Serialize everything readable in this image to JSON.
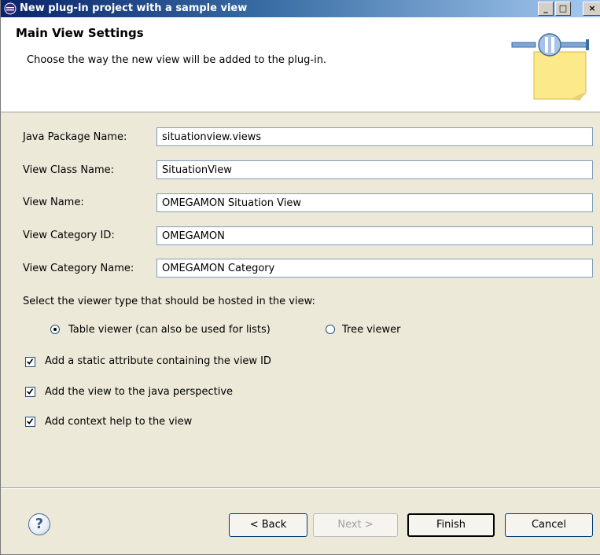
{
  "window": {
    "title": "New plug-in project with a sample view",
    "min_label": "_",
    "max_label": "□",
    "close_label": "×"
  },
  "header": {
    "title": "Main View Settings",
    "description": "Choose the way the new view will be added to the plug-in."
  },
  "form": {
    "fields": [
      {
        "label": "Java Package Name:",
        "value": "situationview.views"
      },
      {
        "label": "View Class Name:",
        "value": "SituationView"
      },
      {
        "label": "View Name:",
        "value": "OMEGAMON Situation View"
      },
      {
        "label": "View Category ID:",
        "value": "OMEGAMON"
      },
      {
        "label": "View Category Name:",
        "value": "OMEGAMON Category"
      }
    ],
    "viewer_prompt": "Select the viewer type that should be hosted in the view:",
    "viewer_options": [
      {
        "label": "Table viewer (can also be used for lists)",
        "selected": true
      },
      {
        "label": "Tree viewer",
        "selected": false
      }
    ],
    "checkboxes": [
      {
        "label": "Add a static attribute containing the view ID",
        "checked": true
      },
      {
        "label": "Add the view to the java perspective",
        "checked": true
      },
      {
        "label": "Add context help to the view",
        "checked": true
      }
    ]
  },
  "buttons": {
    "help": "?",
    "back": "< Back",
    "next": "Next >",
    "finish": "Finish",
    "cancel": "Cancel"
  },
  "colors": {
    "title_bar": "#0a246a",
    "dialog_bg": "#ece9d8",
    "field_border": "#7f9db9"
  }
}
